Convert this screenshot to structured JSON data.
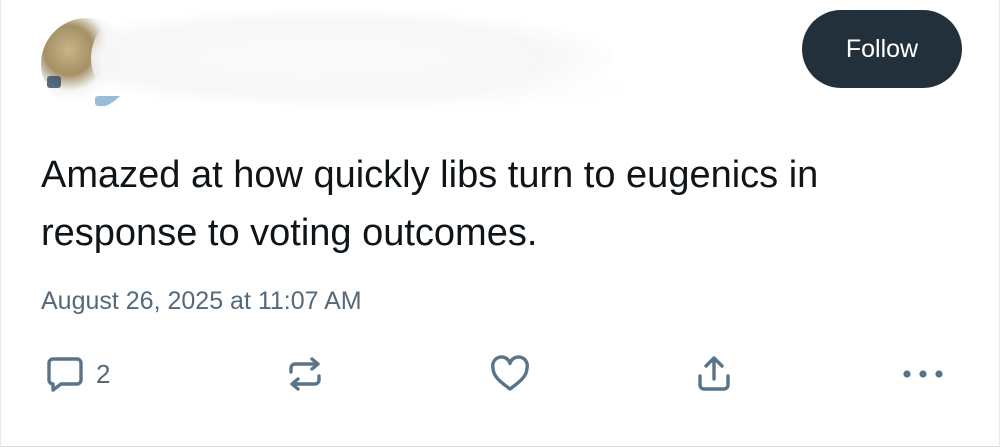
{
  "post": {
    "follow_label": "Follow",
    "text": "Amazed at how quickly libs turn to eugenics in response to voting outcomes.",
    "timestamp": "August 26, 2025 at 11:07 AM",
    "reply_count": "2"
  },
  "icons": {
    "reply": "speech-bubble-icon",
    "repost": "repost-arrows-icon",
    "like": "heart-icon",
    "share": "share-upload-icon",
    "more": "ellipsis-icon"
  },
  "colors": {
    "text": "#0f1419",
    "secondary": "#56697a",
    "icon": "#5a7387",
    "follow_bg": "#22303c",
    "follow_text": "#ffffff"
  }
}
